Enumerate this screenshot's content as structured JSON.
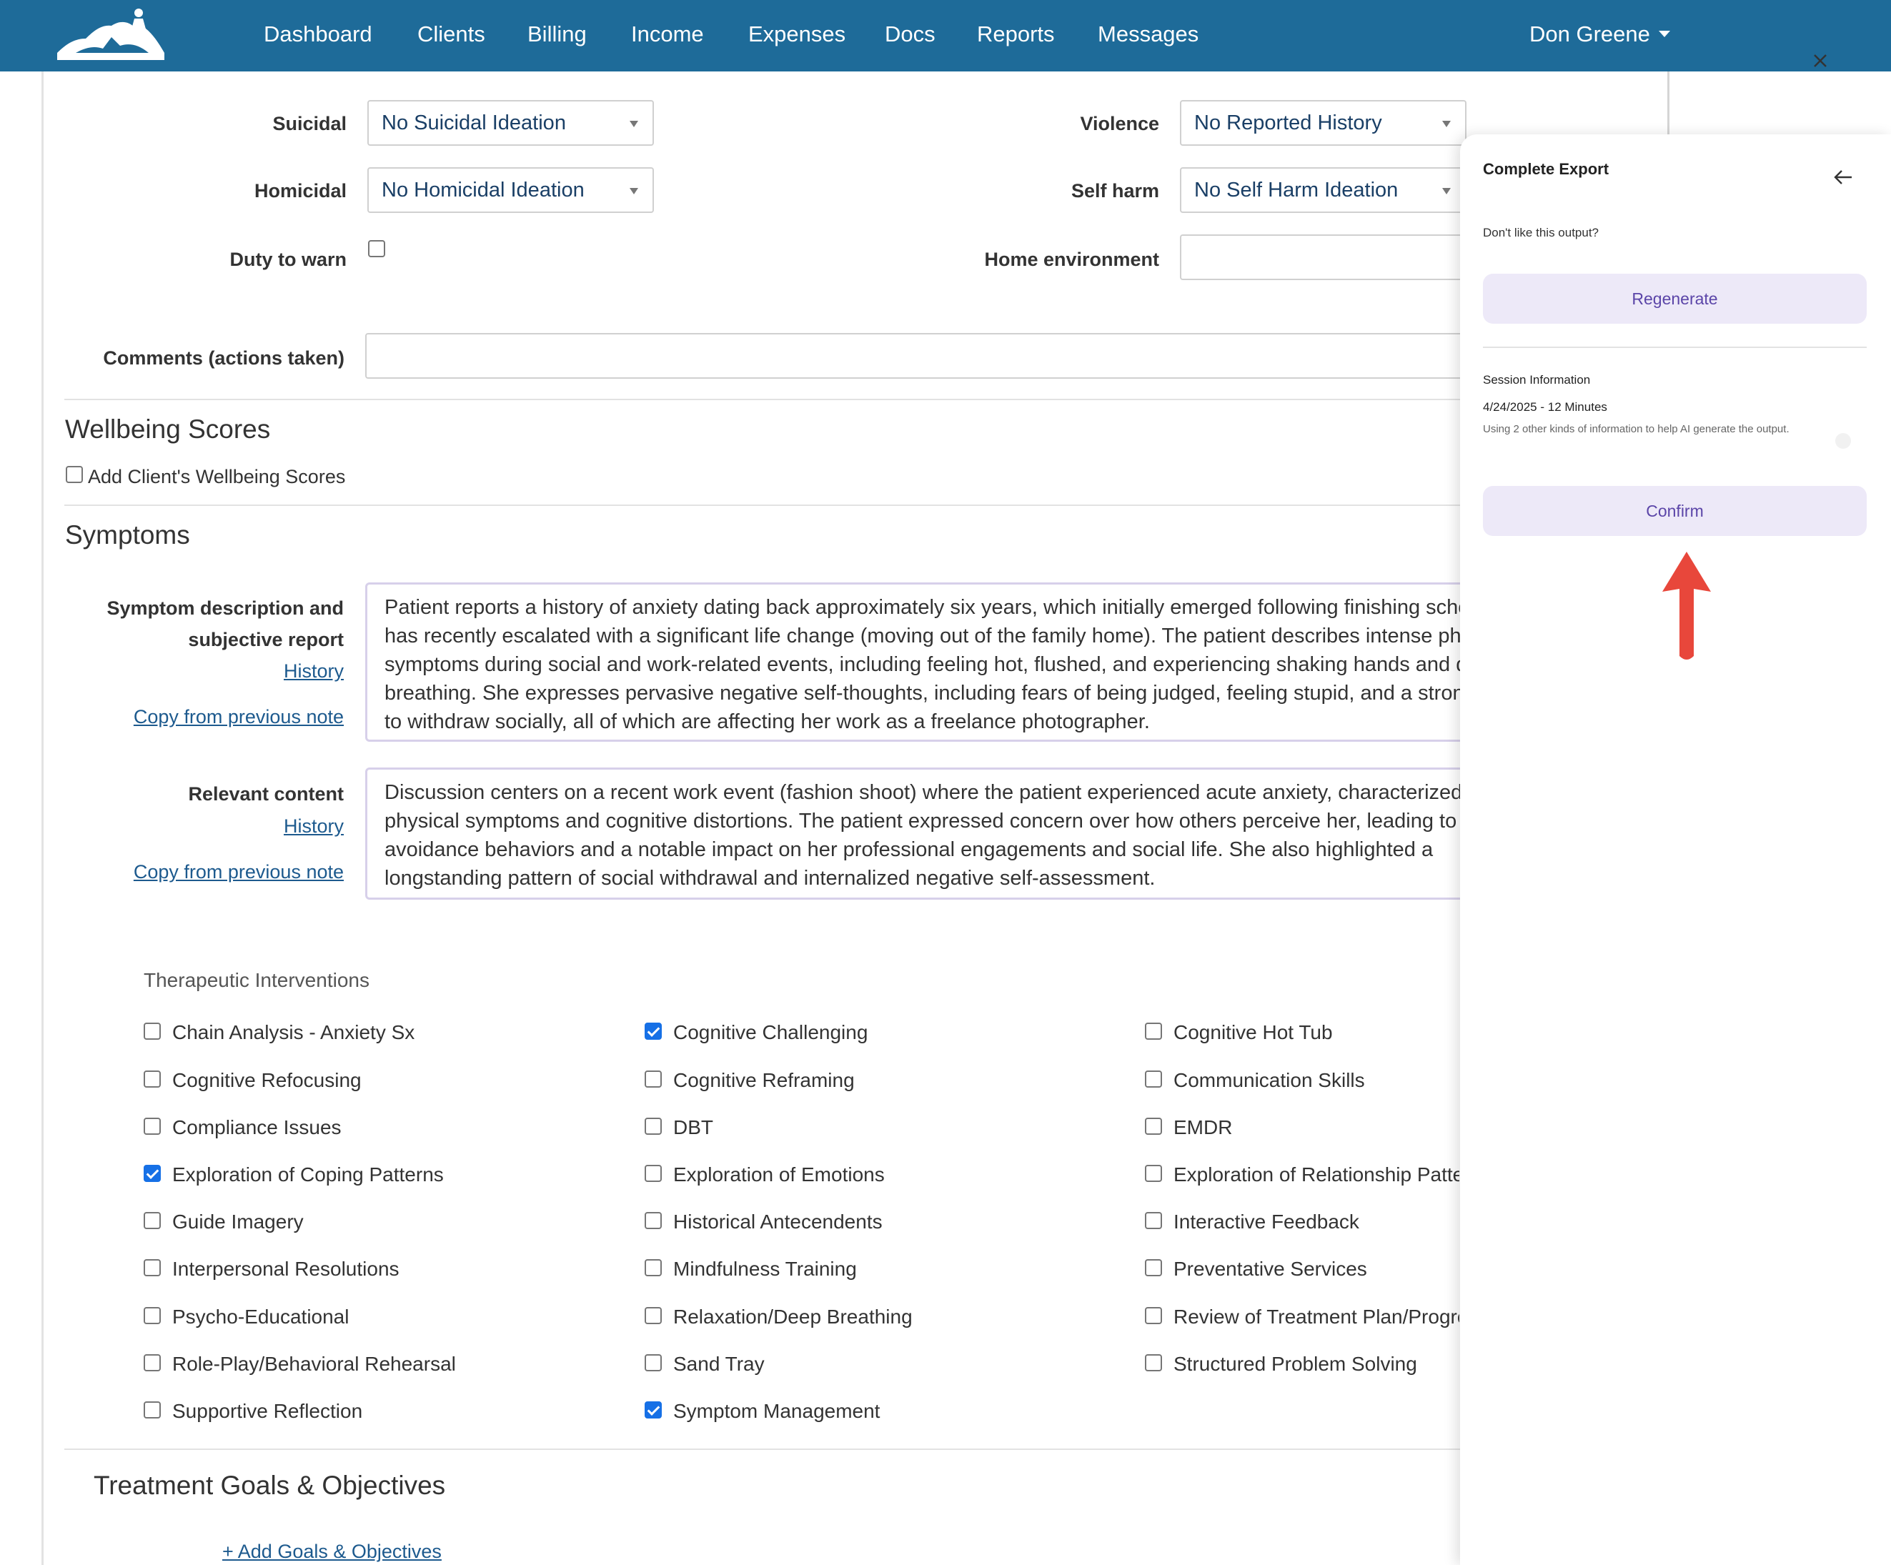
{
  "nav": {
    "items": [
      "Dashboard",
      "Clients",
      "Billing",
      "Income",
      "Expenses",
      "Docs",
      "Reports",
      "Messages"
    ],
    "user": "Don Greene"
  },
  "risk": {
    "suicidal_label": "Suicidal",
    "suicidal_value": "No Suicidal Ideation",
    "violence_label": "Violence",
    "violence_value": "No Reported History",
    "homicidal_label": "Homicidal",
    "homicidal_value": "No Homicidal Ideation",
    "selfharm_label": "Self harm",
    "selfharm_value": "No Self Harm Ideation",
    "duty_label": "Duty to warn",
    "duty_checked": false,
    "home_label": "Home environment",
    "home_value": "",
    "comments_label": "Comments (actions taken)",
    "comments_value": ""
  },
  "wellbeing": {
    "title": "Wellbeing Scores",
    "checkbox_label": "Add Client's Wellbeing Scores",
    "checked": false
  },
  "symptoms": {
    "title": "Symptoms",
    "desc_label_line1": "Symptom description and",
    "desc_label_line2": "subjective report",
    "history_link": "History",
    "copy_link": "Copy from previous note",
    "desc_text": "Patient reports a history of anxiety dating back approximately six years, which initially emerged following finishing school and has recently escalated with a significant life change (moving out of the family home). The patient describes intense physical symptoms during social and work-related events, including feeling hot, flushed, and experiencing shaking hands and difficulty breathing. She expresses pervasive negative self-thoughts, including fears of being judged, feeling stupid, and a strong desire to withdraw socially, all of which are affecting her work as a freelance photographer.",
    "relevant_label": "Relevant content",
    "relevant_text": "Discussion centers on a recent work event (fashion shoot) where the patient experienced acute anxiety, characterized by physical symptoms and cognitive distortions. The patient expressed concern over how others perceive her, leading to avoidance behaviors and a notable impact on her professional engagements and social life. She also highlighted a longstanding pattern of social withdrawal and internalized negative self-assessment."
  },
  "interventions": {
    "title": "Therapeutic Interventions",
    "items": [
      {
        "label": "Chain Analysis - Anxiety Sx",
        "checked": false
      },
      {
        "label": "Cognitive Challenging",
        "checked": true
      },
      {
        "label": "Cognitive Hot Tub",
        "checked": false
      },
      {
        "label": "Cognitive Refocusing",
        "checked": false
      },
      {
        "label": "Cognitive Reframing",
        "checked": false
      },
      {
        "label": "Communication Skills",
        "checked": false
      },
      {
        "label": "Compliance Issues",
        "checked": false
      },
      {
        "label": "DBT",
        "checked": false
      },
      {
        "label": "EMDR",
        "checked": false
      },
      {
        "label": "Exploration of Coping Patterns",
        "checked": true
      },
      {
        "label": "Exploration of Emotions",
        "checked": false
      },
      {
        "label": "Exploration of Relationship Patterns",
        "checked": false
      },
      {
        "label": "Guide Imagery",
        "checked": false
      },
      {
        "label": "Historical Antecendents",
        "checked": false
      },
      {
        "label": "Interactive Feedback",
        "checked": false
      },
      {
        "label": "Interpersonal Resolutions",
        "checked": false
      },
      {
        "label": "Mindfulness Training",
        "checked": false
      },
      {
        "label": "Preventative Services",
        "checked": false
      },
      {
        "label": "Psycho-Educational",
        "checked": false
      },
      {
        "label": "Relaxation/Deep Breathing",
        "checked": false
      },
      {
        "label": "Review of Treatment Plan/Progress",
        "checked": false
      },
      {
        "label": "Role-Play/Behavioral Rehearsal",
        "checked": false
      },
      {
        "label": "Sand Tray",
        "checked": false
      },
      {
        "label": "Structured Problem Solving",
        "checked": false
      },
      {
        "label": "Supportive Reflection",
        "checked": false
      },
      {
        "label": "Symptom Management",
        "checked": true
      }
    ]
  },
  "goals": {
    "title": "Treatment Goals & Objectives",
    "add_link": "+ Add Goals & Objectives"
  },
  "panel": {
    "title": "Complete Export",
    "question": "Don't like this output?",
    "regenerate": "Regenerate",
    "session_title": "Session Information",
    "session_date": "4/24/2025 - 12 Minutes",
    "session_desc": "Using 2 other kinds of information to help AI generate the output.",
    "confirm": "Confirm"
  },
  "colors": {
    "navbar": "#1e6b99",
    "panel_button_bg": "#ede9f8",
    "panel_button_text": "#5b45a8",
    "checkbox_checked": "#1670e6",
    "annotation_arrow": "#e8473b"
  },
  "icons": {
    "logo": "horses-logo",
    "close": "close-icon",
    "back": "arrow-left-icon",
    "dropdown": "caret-down-icon"
  }
}
